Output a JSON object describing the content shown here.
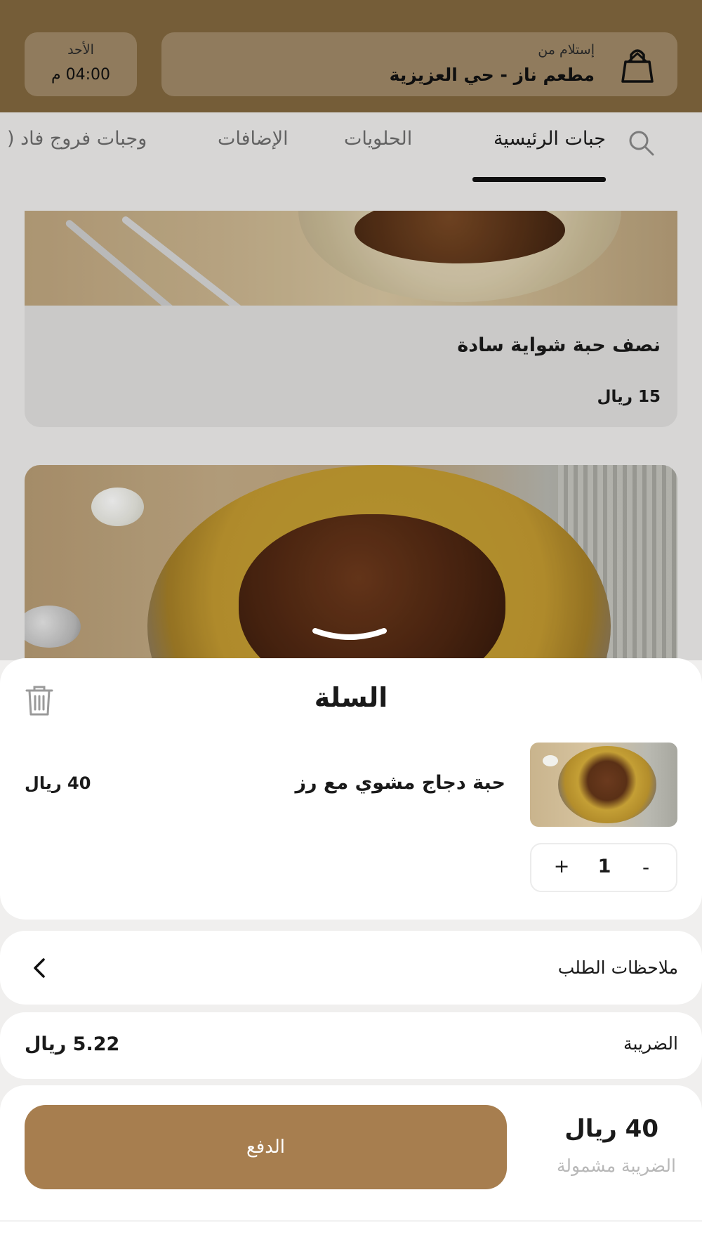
{
  "header": {
    "pickup_label": "إستلام من",
    "location": "مطعم ناز - حي العزيزية",
    "day": "الأحد",
    "time": "04:00 م",
    "bag_icon": "shopping-bag-icon",
    "color": "#83683f"
  },
  "tabs": {
    "items": [
      {
        "label": "جبات الرئيسية",
        "active": true
      },
      {
        "label": "الحلويات",
        "active": false
      },
      {
        "label": "الإضافات",
        "active": false
      },
      {
        "label": "وجبات فروج فاد (",
        "active": false
      }
    ],
    "search_icon": "search-icon"
  },
  "menu": {
    "items": [
      {
        "name": "نصف حبة شواية سادة",
        "price": "15 ريال"
      }
    ]
  },
  "cart": {
    "title": "السلة",
    "trash_icon": "trash-icon",
    "item": {
      "name": "حبة دجاج مشوي مع رز",
      "price": "40 ريال",
      "quantity": "1",
      "minus_label": "-",
      "plus_label": "+"
    },
    "notes_label": "ملاحظات الطلب",
    "tax_label": "الضريبة",
    "tax_value": "5.22 ريال",
    "total": "40 ريال",
    "tax_included_label": "الضريبة مشمولة",
    "pay_label": "الدفع",
    "pay_color": "#a77e4f"
  }
}
